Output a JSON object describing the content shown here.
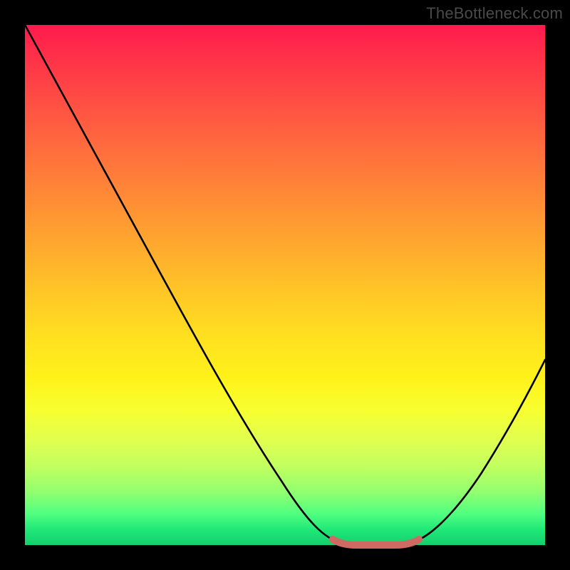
{
  "watermark": "TheBottleneck.com",
  "colors": {
    "background": "#000000",
    "gradient_top": "#ff1a4d",
    "gradient_bottom": "#14cf6e",
    "curve": "#000000",
    "trough_accent": "#cf6a63"
  },
  "chart_data": {
    "type": "line",
    "title": "",
    "xlabel": "",
    "ylabel": "",
    "xlim": [
      0,
      100
    ],
    "ylim": [
      0,
      100
    ],
    "grid": false,
    "legend": false,
    "series": [
      {
        "name": "bottleneck-curve",
        "x": [
          0,
          5,
          10,
          15,
          20,
          25,
          30,
          35,
          40,
          45,
          50,
          55,
          58,
          62,
          66,
          70,
          74,
          78,
          82,
          86,
          90,
          94,
          98,
          100
        ],
        "values": [
          100,
          92,
          84,
          76,
          68,
          60,
          52,
          44,
          36,
          28,
          20,
          12,
          6,
          2,
          0,
          0,
          0,
          2,
          7,
          13,
          20,
          28,
          36,
          40
        ]
      }
    ],
    "annotations": [
      {
        "name": "trough-accent",
        "x_range": [
          58,
          76
        ],
        "y": 1
      }
    ]
  }
}
